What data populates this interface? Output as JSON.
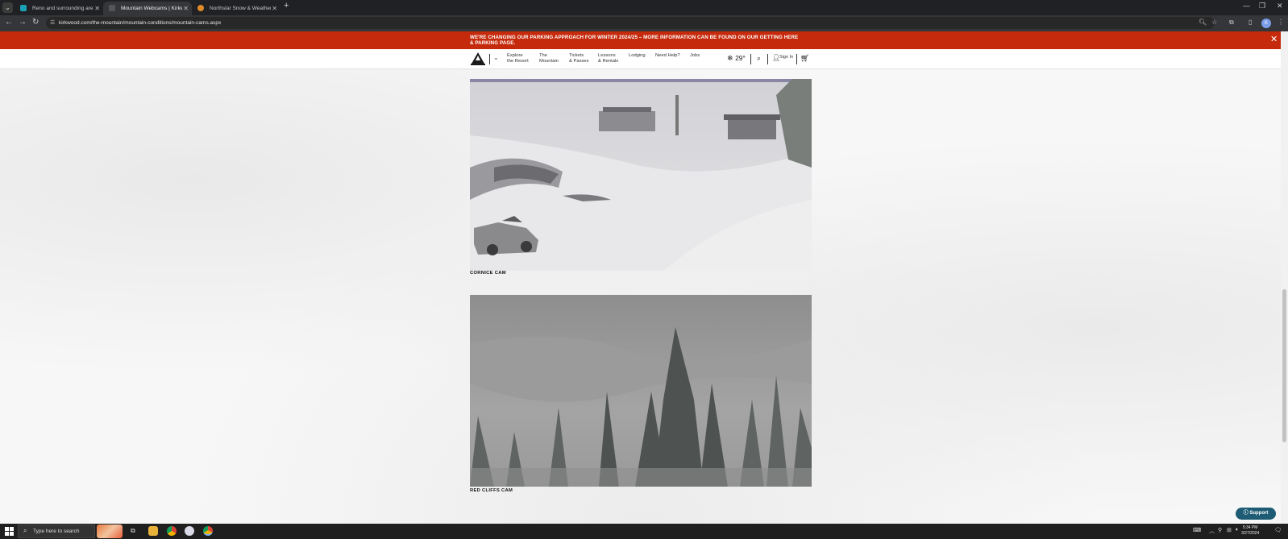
{
  "browser": {
    "tabs": [
      {
        "label": "Reno and surrounding areas Cl",
        "favicon_color": "#1aa1b5",
        "active": false
      },
      {
        "label": "Mountain Webcams | Kirkwood",
        "favicon_color": "#333333",
        "active": true
      },
      {
        "label": "Northstar Snow & Weather Re",
        "favicon_color": "#e08a2a",
        "active": false
      }
    ],
    "new_tab": "+",
    "url": "kirkwood.com/the-mountain/mountain-conditions/mountain-cams.aspx",
    "profile_initial": "K"
  },
  "banner": {
    "text": "WE'RE CHANGING OUR PARKING APPROACH FOR WINTER 2024/25 – MORE INFORMATION CAN BE FOUND ON OUR GETTING HERE & PARKING PAGE.",
    "close": "✕",
    "color": "#c52a0d"
  },
  "site_nav": {
    "items": [
      {
        "line1": "Explore",
        "line2": "the Resort"
      },
      {
        "line1": "The",
        "line2": "Mountain"
      },
      {
        "line1": "Tickets",
        "line2": "& Passes"
      },
      {
        "line1": "Lessons",
        "line2": "& Rentals"
      },
      {
        "line1": "Lodging",
        "line2": ""
      },
      {
        "line1": "Need Help?",
        "line2": ""
      },
      {
        "line1": "Jobs",
        "line2": ""
      }
    ],
    "weather_icon": "snowflake-icon",
    "temperature": "29°",
    "sign_in": "Sign In"
  },
  "cams": [
    {
      "label": "CORNICE CAM"
    },
    {
      "label": "RED CLIFFS CAM"
    }
  ],
  "support": "Support",
  "taskbar": {
    "search_placeholder": "Type here to search",
    "time": "5:34 PM",
    "date": "3/27/2024"
  }
}
